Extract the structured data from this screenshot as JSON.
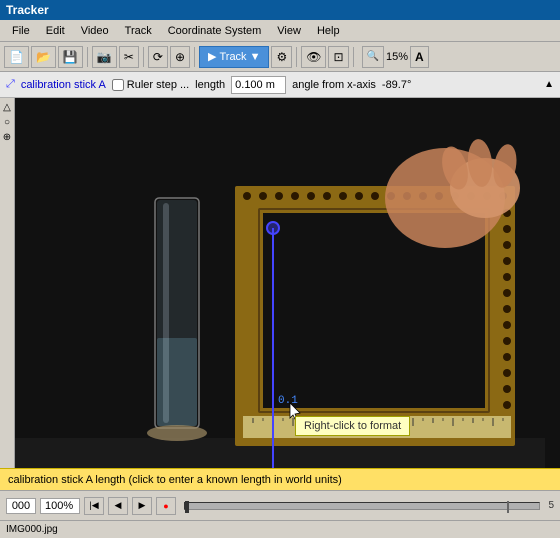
{
  "titleBar": {
    "title": "Tracker"
  },
  "menuBar": {
    "items": [
      "File",
      "Edit",
      "Video",
      "Track",
      "Coordinate System",
      "View",
      "Help"
    ]
  },
  "toolbar": {
    "trackButtonLabel": "Track",
    "zoomLevel": "15%",
    "buttons": [
      "new",
      "open",
      "save",
      "camera",
      "clip",
      "refresh",
      "axes",
      "track",
      "calibrate",
      "zoom-in",
      "zoom-out",
      "zoom-percent",
      "font"
    ]
  },
  "trackToolbar": {
    "calibrationLabel": "calibration stick A",
    "rulerLabel": "Ruler step ...",
    "lengthLabel": "length",
    "lengthValue": "0.100 m",
    "angleLabel": "angle from x-axis",
    "angleValue": "-89.7°"
  },
  "video": {
    "tooltip": "Right-click to format",
    "calibLabel": "0.1"
  },
  "statusBar": {
    "text": "calibration stick A length (click to enter a known length in world units)"
  },
  "bottomControls": {
    "frameNumber": "000",
    "zoomPercent": "100%",
    "frameEnd": "5"
  },
  "footer": {
    "filename": "IMG000.jpg"
  }
}
